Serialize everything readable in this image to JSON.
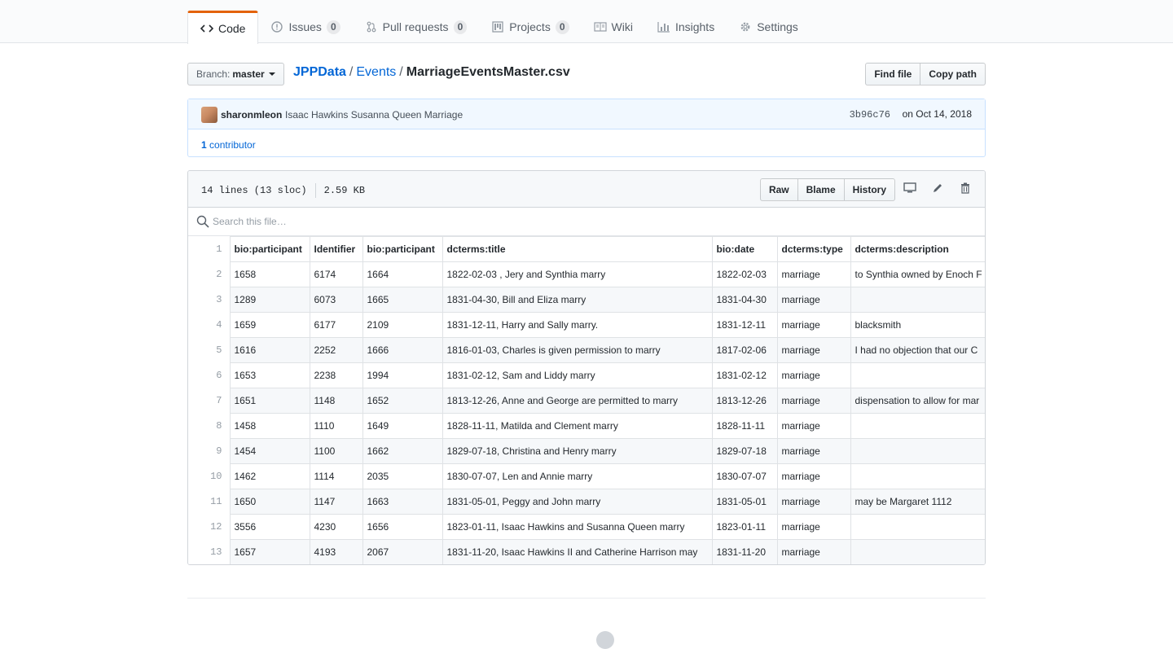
{
  "nav": {
    "tabs": [
      {
        "label": "Code",
        "icon": "code-icon"
      },
      {
        "label": "Issues",
        "count": "0",
        "icon": "issue-icon"
      },
      {
        "label": "Pull requests",
        "count": "0",
        "icon": "pull-request-icon"
      },
      {
        "label": "Projects",
        "count": "0",
        "icon": "project-icon"
      },
      {
        "label": "Wiki",
        "icon": "book-icon"
      },
      {
        "label": "Insights",
        "icon": "graph-icon"
      },
      {
        "label": "Settings",
        "icon": "gear-icon"
      }
    ],
    "accent_color": "#e36209"
  },
  "branch": {
    "prefix": "Branch:",
    "name": "master"
  },
  "breadcrumb": {
    "repo": "JPPData",
    "sep": "/",
    "folder": "Events",
    "file": "MarriageEventsMaster.csv"
  },
  "file_buttons": {
    "find": "Find file",
    "copy": "Copy path"
  },
  "commit": {
    "author": "sharonmleon",
    "message": "Isaac Hawkins Susanna Queen Marriage",
    "sha": "3b96c76",
    "date": "on Oct 14, 2018",
    "contributors_count": "1",
    "contributors_label": "contributor"
  },
  "file": {
    "lines": "14 lines (13 sloc)",
    "size": "2.59 KB",
    "actions": {
      "raw": "Raw",
      "blame": "Blame",
      "history": "History"
    },
    "search_placeholder": "Search this file…"
  },
  "table": {
    "headers": [
      "bio:participant",
      "Identifier",
      "bio:participant",
      "dcterms:title",
      "bio:date",
      "dcterms:type",
      "dcterms:description"
    ],
    "rows": [
      {
        "n": "2",
        "cells": [
          "1658",
          "6174",
          "1664",
          "1822-02-03 , Jery and Synthia marry",
          "1822-02-03",
          "marriage",
          "to Synthia owned by Enoch F"
        ]
      },
      {
        "n": "3",
        "cells": [
          "1289",
          "6073",
          "1665",
          "1831-04-30, Bill and Eliza marry",
          "1831-04-30",
          "marriage",
          ""
        ]
      },
      {
        "n": "4",
        "cells": [
          "1659",
          "6177",
          "2109",
          "1831-12-11, Harry and Sally marry.",
          "1831-12-11",
          "marriage",
          "blacksmith"
        ]
      },
      {
        "n": "5",
        "cells": [
          "1616",
          "2252",
          "1666",
          "1816-01-03, Charles is given permission to marry",
          "1817-02-06",
          "marriage",
          "I had no objection that our C"
        ]
      },
      {
        "n": "6",
        "cells": [
          "1653",
          "2238",
          "1994",
          "1831-02-12, Sam and Liddy marry",
          "1831-02-12",
          "marriage",
          ""
        ]
      },
      {
        "n": "7",
        "cells": [
          "1651",
          "1148",
          "1652",
          "1813-12-26, Anne and George are permitted to marry",
          "1813-12-26",
          "marriage",
          "dispensation to allow for mar"
        ]
      },
      {
        "n": "8",
        "cells": [
          "1458",
          "1110",
          "1649",
          "1828-11-11, Matilda and Clement marry",
          "1828-11-11",
          "marriage",
          ""
        ]
      },
      {
        "n": "9",
        "cells": [
          "1454",
          "1100",
          "1662",
          "1829-07-18, Christina and Henry marry",
          "1829-07-18",
          "marriage",
          ""
        ]
      },
      {
        "n": "10",
        "cells": [
          "1462",
          "1114",
          "2035",
          "1830-07-07, Len and Annie marry",
          "1830-07-07",
          "marriage",
          ""
        ]
      },
      {
        "n": "11",
        "cells": [
          "1650",
          "1147",
          "1663",
          "1831-05-01, Peggy and John marry",
          "1831-05-01",
          "marriage",
          "may be Margaret 1112"
        ]
      },
      {
        "n": "12",
        "cells": [
          "3556",
          "4230",
          "1656",
          "1823-01-11, Isaac Hawkins and Susanna Queen marry",
          "1823-01-11",
          "marriage",
          ""
        ]
      },
      {
        "n": "13",
        "cells": [
          "1657",
          "4193",
          "2067",
          "1831-11-20, Isaac Hawkins II and Catherine Harrison may",
          "1831-11-20",
          "marriage",
          ""
        ]
      }
    ]
  }
}
